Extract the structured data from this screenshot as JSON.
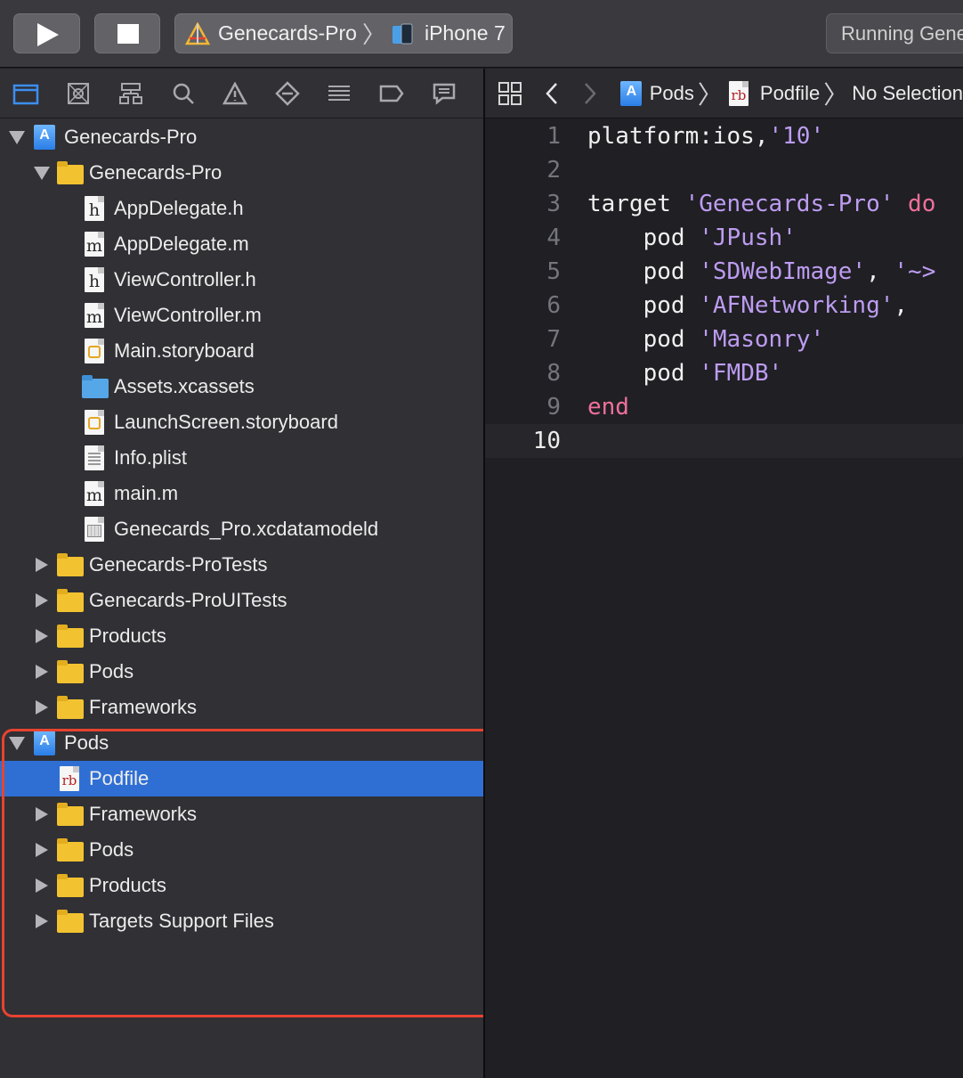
{
  "toolbar": {
    "scheme_project": "Genecards-Pro",
    "scheme_device": "iPhone 7",
    "activity_text": "Running Gene"
  },
  "navigator": {
    "tabs": [
      "folder-icon",
      "source-control-icon",
      "hierarchy-icon",
      "search-icon",
      "warning-icon",
      "breakpoint-icon",
      "tests-icon",
      "tag-icon",
      "report-icon"
    ],
    "tree": [
      {
        "label": "Genecards-Pro",
        "icon": "project-icon",
        "disclosure": "open",
        "indent": 0
      },
      {
        "label": "Genecards-Pro",
        "icon": "folder-icon",
        "disclosure": "open",
        "indent": 1
      },
      {
        "label": "AppDelegate.h",
        "icon": "h-file-icon",
        "letter": "h",
        "disclosure": "none",
        "indent": 2
      },
      {
        "label": "AppDelegate.m",
        "icon": "m-file-icon",
        "letter": "m",
        "disclosure": "none",
        "indent": 2
      },
      {
        "label": "ViewController.h",
        "icon": "h-file-icon",
        "letter": "h",
        "disclosure": "none",
        "indent": 2
      },
      {
        "label": "ViewController.m",
        "icon": "m-file-icon",
        "letter": "m",
        "disclosure": "none",
        "indent": 2
      },
      {
        "label": "Main.storyboard",
        "icon": "storyboard-icon",
        "disclosure": "none",
        "indent": 2
      },
      {
        "label": "Assets.xcassets",
        "icon": "assets-folder-icon",
        "disclosure": "none",
        "indent": 2
      },
      {
        "label": "LaunchScreen.storyboard",
        "icon": "storyboard-icon",
        "disclosure": "none",
        "indent": 2
      },
      {
        "label": "Info.plist",
        "icon": "plist-icon",
        "disclosure": "none",
        "indent": 2
      },
      {
        "label": "main.m",
        "icon": "m-file-icon",
        "letter": "m",
        "disclosure": "none",
        "indent": 2
      },
      {
        "label": "Genecards_Pro.xcdatamodeld",
        "icon": "core-data-icon",
        "disclosure": "none",
        "indent": 2
      },
      {
        "label": "Genecards-ProTests",
        "icon": "folder-icon",
        "disclosure": "closed",
        "indent": 1
      },
      {
        "label": "Genecards-ProUITests",
        "icon": "folder-icon",
        "disclosure": "closed",
        "indent": 1
      },
      {
        "label": "Products",
        "icon": "folder-icon",
        "disclosure": "closed",
        "indent": 1
      },
      {
        "label": "Pods",
        "icon": "folder-icon",
        "disclosure": "closed",
        "indent": 1
      },
      {
        "label": "Frameworks",
        "icon": "folder-icon",
        "disclosure": "closed",
        "indent": 1
      },
      {
        "label": "Pods",
        "icon": "project-icon",
        "disclosure": "open",
        "indent": 0
      },
      {
        "label": "Podfile",
        "icon": "ruby-file-icon",
        "letter": "rb",
        "disclosure": "none",
        "indent": 1,
        "selected": true
      },
      {
        "label": "Frameworks",
        "icon": "folder-icon",
        "disclosure": "closed",
        "indent": 1
      },
      {
        "label": "Pods",
        "icon": "folder-icon",
        "disclosure": "closed",
        "indent": 1
      },
      {
        "label": "Products",
        "icon": "folder-icon",
        "disclosure": "closed",
        "indent": 1
      },
      {
        "label": "Targets Support Files",
        "icon": "folder-icon",
        "disclosure": "closed",
        "indent": 1
      }
    ]
  },
  "editor": {
    "breadcrumb": {
      "project": "Pods",
      "file": "Podfile",
      "symbol": "No Selection",
      "file_icon_letter": "rb"
    },
    "lines": [
      {
        "num": "1",
        "tokens": [
          {
            "t": "platform:ios,",
            "c": "plain"
          },
          {
            "t": "'10'",
            "c": "str"
          }
        ]
      },
      {
        "num": "2",
        "tokens": []
      },
      {
        "num": "3",
        "tokens": [
          {
            "t": "target ",
            "c": "plain"
          },
          {
            "t": "'Genecards-Pro'",
            "c": "str"
          },
          {
            "t": " do",
            "c": "kw"
          }
        ]
      },
      {
        "num": "4",
        "tokens": [
          {
            "t": "    pod ",
            "c": "plain"
          },
          {
            "t": "'JPush'",
            "c": "str"
          }
        ]
      },
      {
        "num": "5",
        "tokens": [
          {
            "t": "    pod ",
            "c": "plain"
          },
          {
            "t": "'SDWebImage'",
            "c": "str"
          },
          {
            "t": ", ",
            "c": "plain"
          },
          {
            "t": "'~>",
            "c": "str"
          }
        ]
      },
      {
        "num": "6",
        "tokens": [
          {
            "t": "    pod ",
            "c": "plain"
          },
          {
            "t": "'AFNetworking'",
            "c": "str"
          },
          {
            "t": ",",
            "c": "plain"
          }
        ]
      },
      {
        "num": "7",
        "tokens": [
          {
            "t": "    pod ",
            "c": "plain"
          },
          {
            "t": "'Masonry'",
            "c": "str"
          }
        ]
      },
      {
        "num": "8",
        "tokens": [
          {
            "t": "    pod ",
            "c": "plain"
          },
          {
            "t": "'FMDB'",
            "c": "str"
          }
        ]
      },
      {
        "num": "9",
        "tokens": [
          {
            "t": "end",
            "c": "kw"
          }
        ]
      },
      {
        "num": "10",
        "tokens": [],
        "current": true
      }
    ]
  },
  "colors": {
    "selection": "#2f6fd4",
    "highlight_box": "#e8432f",
    "string": "#bd9cf0",
    "keyword": "#f0709a"
  }
}
